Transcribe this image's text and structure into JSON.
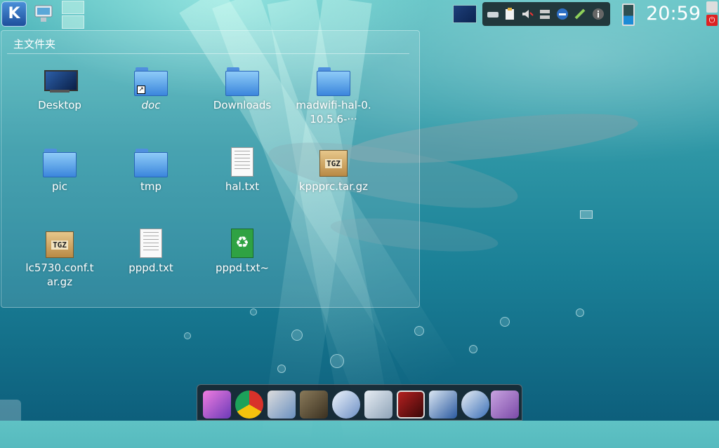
{
  "colors": {
    "accent": "#3b86dc",
    "panel": "#141e23",
    "power": "#dd2222"
  },
  "topbar": {
    "kickoff_icon": "kde-logo-icon",
    "clock": "20:59",
    "tray_icons": [
      "network-icon",
      "clipboard-icon",
      "volume-muted-icon",
      "wired-network-icon",
      "bluetooth-icon",
      "connection-icon",
      "info-icon"
    ]
  },
  "folderview": {
    "title": "主文件夹",
    "items": [
      {
        "label": "Desktop",
        "icon": "desktop-icon"
      },
      {
        "label": "doc",
        "icon": "folder-link-icon"
      },
      {
        "label": "Downloads",
        "icon": "folder-icon"
      },
      {
        "label": "madwifi-hal-0.10.5.6-···",
        "icon": "folder-icon"
      },
      {
        "label": "pic",
        "icon": "folder-icon"
      },
      {
        "label": "tmp",
        "icon": "folder-icon"
      },
      {
        "label": "hal.txt",
        "icon": "text-file-icon"
      },
      {
        "label": "kppprc.tar.gz",
        "icon": "tgz-archive-icon",
        "badge": "TGZ"
      },
      {
        "label": "lc5730.conf.tar.gz",
        "icon": "tgz-archive-icon",
        "badge": "TGZ"
      },
      {
        "label": "pppd.txt",
        "icon": "text-file-icon"
      },
      {
        "label": "pppd.txt~",
        "icon": "recycle-file-icon"
      }
    ]
  },
  "dock": {
    "apps": [
      "kde-launcher-icon",
      "chrome-icon",
      "media-player-icon",
      "gimp-icon",
      "thunderbird-icon",
      "settings-tools-icon",
      "terminal-icon",
      "network-manager-icon",
      "remote-desktop-icon",
      "pidgin-icon"
    ]
  }
}
